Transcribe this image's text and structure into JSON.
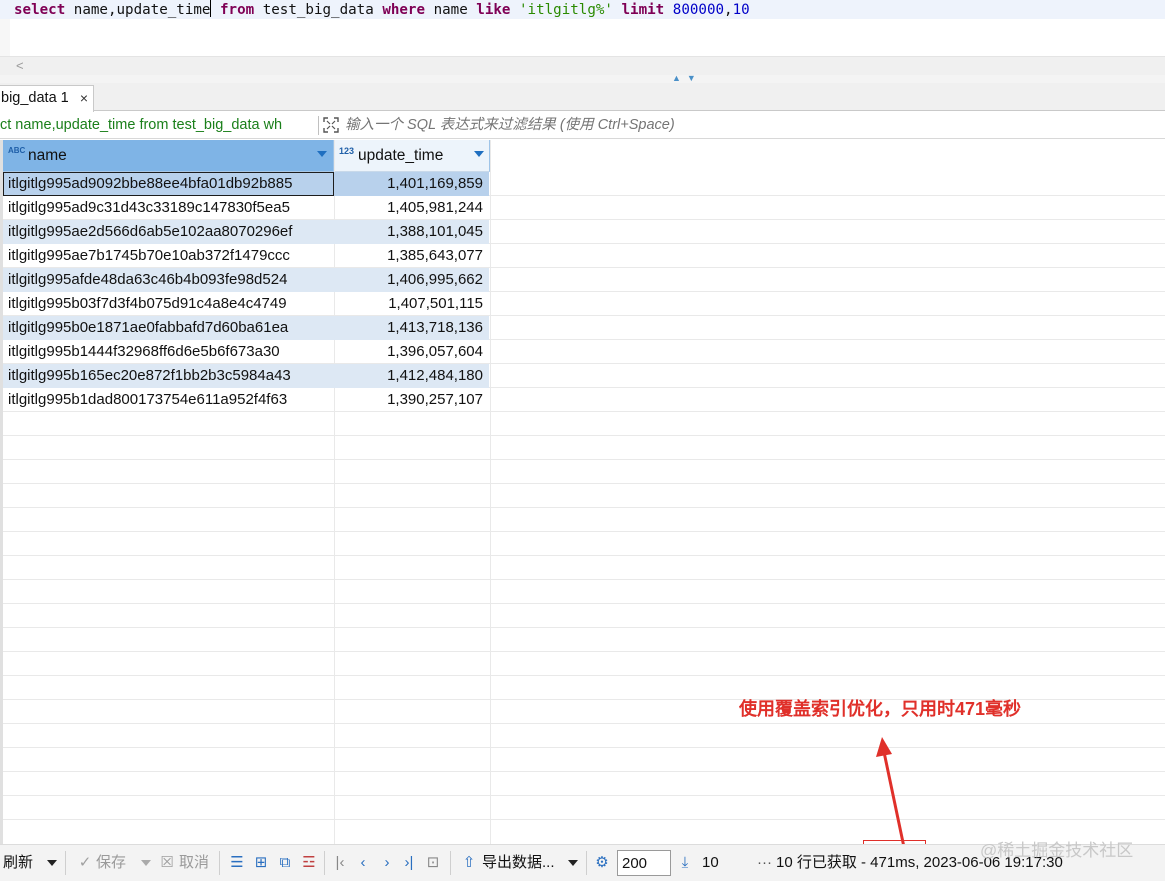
{
  "editor": {
    "sql_parts": [
      {
        "t": "select",
        "c": "kw"
      },
      {
        "t": " name,update_time",
        "c": "id"
      },
      {
        "t": " ",
        "c": "id"
      },
      {
        "t": "from",
        "c": "kw"
      },
      {
        "t": " test_big_data ",
        "c": "id"
      },
      {
        "t": "where",
        "c": "kw"
      },
      {
        "t": " name ",
        "c": "id"
      },
      {
        "t": "like",
        "c": "kw"
      },
      {
        "t": " ",
        "c": "id"
      },
      {
        "t": "'itlgitlg%'",
        "c": "str"
      },
      {
        "t": " ",
        "c": "id"
      },
      {
        "t": "limit",
        "c": "kw"
      },
      {
        "t": " ",
        "c": "id"
      },
      {
        "t": "800000",
        "c": "num"
      },
      {
        "t": ",",
        "c": "id"
      },
      {
        "t": "10",
        "c": "num"
      }
    ]
  },
  "hscroll": {
    "left_arrow": "<"
  },
  "result_tab": {
    "label": "big_data 1",
    "close": "×"
  },
  "filter": {
    "query_preview": "ct name,update_time from test_big_data wh",
    "placeholder": "输入一个 SQL 表达式来过滤结果 (使用 Ctrl+Space)"
  },
  "grid": {
    "columns": [
      {
        "type": "ABC",
        "label": "name"
      },
      {
        "type": "123",
        "label": "update_time"
      }
    ],
    "rows": [
      {
        "name": "itlgitlg995ad9092bbe88ee4bfa01db92b885",
        "update_time": "1,401,169,859"
      },
      {
        "name": "itlgitlg995ad9c31d43c33189c147830f5ea5",
        "update_time": "1,405,981,244"
      },
      {
        "name": "itlgitlg995ae2d566d6ab5e102aa8070296ef",
        "update_time": "1,388,101,045"
      },
      {
        "name": "itlgitlg995ae7b1745b70e10ab372f1479ccc",
        "update_time": "1,385,643,077"
      },
      {
        "name": "itlgitlg995afde48da63c46b4b093fe98d524",
        "update_time": "1,406,995,662"
      },
      {
        "name": "itlgitlg995b03f7d3f4b075d91c4a8e4c4749",
        "update_time": "1,407,501,115"
      },
      {
        "name": "itlgitlg995b0e1871ae0fabbafd7d60ba61ea",
        "update_time": "1,413,718,136"
      },
      {
        "name": "itlgitlg995b1444f32968ff6d6e5b6f673a30",
        "update_time": "1,396,057,604"
      },
      {
        "name": "itlgitlg995b165ec20e872f1bb2b3c5984a43",
        "update_time": "1,412,484,180"
      },
      {
        "name": "itlgitlg995b1dad800173754e611a952f4f63",
        "update_time": "1,390,257,107"
      }
    ]
  },
  "annotation": {
    "text": "使用覆盖索引优化，只用时471毫秒",
    "color": "#e0302a"
  },
  "statusbar": {
    "refresh": "刷新",
    "save": "保存",
    "cancel": "取消",
    "export": "导出数据...",
    "fetch_size": "200",
    "row_limit": "10",
    "ellipsis": "···",
    "summary": "10 行已获取 - 471ms, 2023-06-06 19:17:30"
  },
  "watermark": "@稀土掘金技术社区"
}
